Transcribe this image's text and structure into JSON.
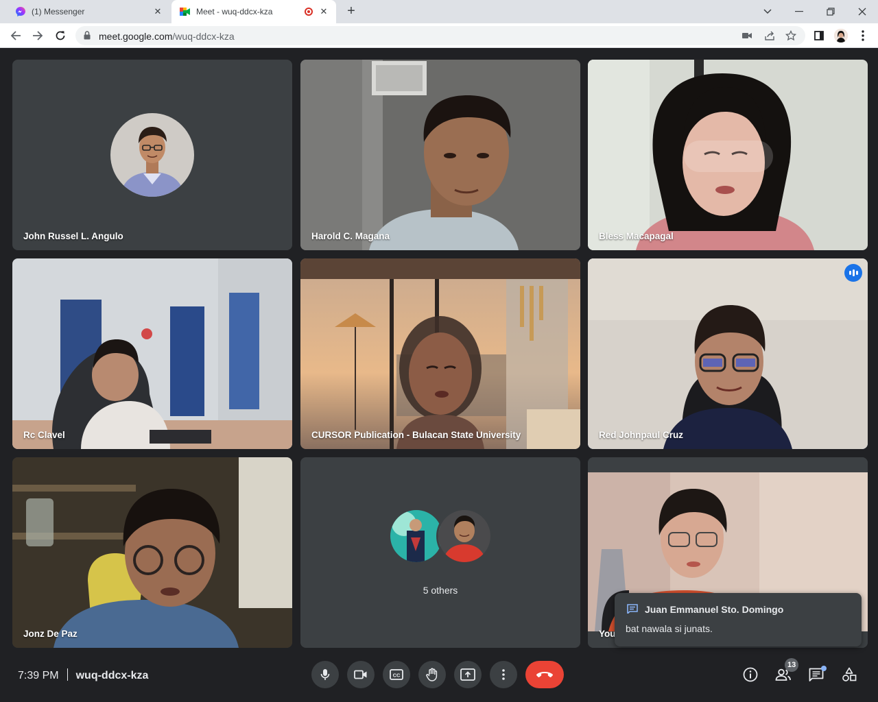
{
  "browser": {
    "tabs": [
      {
        "title": "(1) Messenger",
        "icon": "messenger-icon"
      },
      {
        "title": "Meet - wuq-ddcx-kza",
        "icon": "google-meet-icon",
        "active": true,
        "recording": true
      }
    ],
    "url_host": "meet.google.com",
    "url_path": "/wuq-ddcx-kza"
  },
  "participants": [
    {
      "name": "John Russel L. Angulo",
      "video": false
    },
    {
      "name": "Harold C. Magana",
      "video": true
    },
    {
      "name": "Bless Macapagal",
      "video": true
    },
    {
      "name": "Rc Clavel",
      "video": true
    },
    {
      "name": "CURSOR Publication - Bulacan State University",
      "video": true
    },
    {
      "name": "Red Johnpaul Cruz",
      "video": true,
      "speaking": true
    },
    {
      "name": "Jonz De Paz",
      "video": true
    },
    {
      "name": "You",
      "video": true
    }
  ],
  "others": {
    "label": "5 others"
  },
  "chat_toast": {
    "sender": "Juan Emmanuel Sto. Domingo",
    "message": "bat nawala si junats."
  },
  "meeting": {
    "time": "7:39 PM",
    "code": "wuq-ddcx-kza",
    "people_count": "13"
  },
  "colors": {
    "background": "#202124",
    "tile": "#3c4043",
    "end_call": "#ea4335",
    "speaking": "#8ab4f8",
    "speak_indicator": "#1a73e8"
  }
}
